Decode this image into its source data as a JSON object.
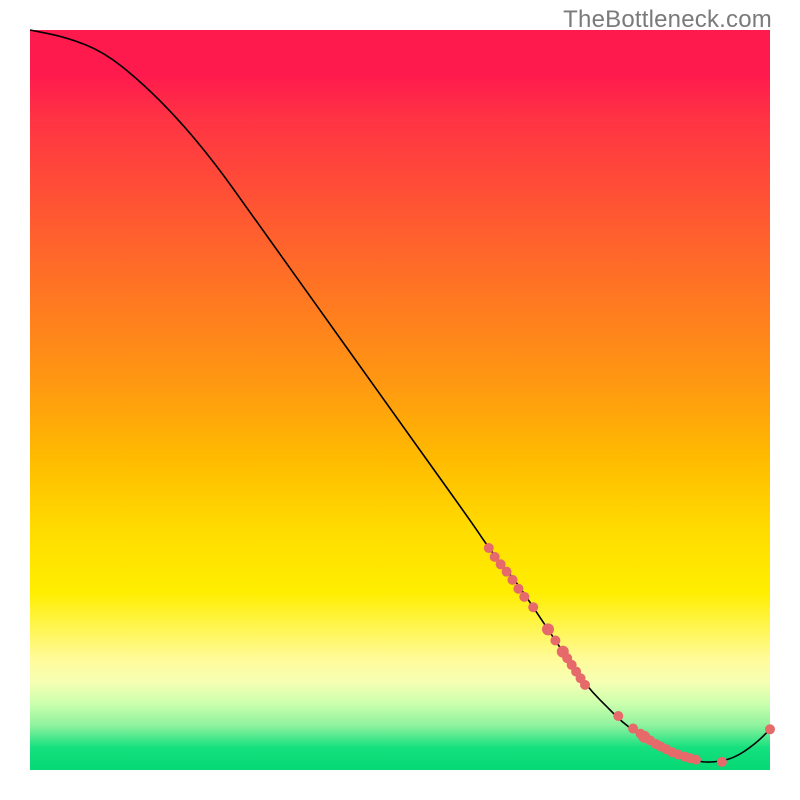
{
  "watermark": "TheBottleneck.com",
  "chart_data": {
    "type": "line",
    "title": "",
    "xlabel": "",
    "ylabel": "",
    "xlim": [
      0,
      100
    ],
    "ylim": [
      0,
      100
    ],
    "grid": false,
    "legend": false,
    "series": [
      {
        "name": "curve",
        "x": [
          0,
          5,
          10,
          15,
          20,
          25,
          30,
          35,
          40,
          45,
          50,
          55,
          60,
          62,
          64,
          66,
          68,
          70,
          72,
          74,
          76,
          78,
          80,
          82,
          84,
          86,
          88,
          90,
          92,
          95,
          98,
          100
        ],
        "y": [
          100,
          99,
          97,
          93,
          88,
          82,
          75,
          68,
          61,
          54,
          47,
          40,
          33,
          30,
          27.5,
          25,
          22,
          19,
          16,
          13,
          10.5,
          8.5,
          6.5,
          5,
          3.5,
          2.5,
          1.8,
          1.2,
          1,
          1.5,
          3.5,
          5.5
        ]
      }
    ],
    "markers": {
      "name": "highlight-points",
      "color": "#e66a6a",
      "points": [
        {
          "x": 62.0,
          "y": 30.0,
          "r": 5
        },
        {
          "x": 62.8,
          "y": 28.8,
          "r": 5
        },
        {
          "x": 63.6,
          "y": 27.8,
          "r": 5
        },
        {
          "x": 64.4,
          "y": 26.8,
          "r": 5
        },
        {
          "x": 65.2,
          "y": 25.7,
          "r": 5
        },
        {
          "x": 66.0,
          "y": 24.5,
          "r": 5
        },
        {
          "x": 66.8,
          "y": 23.4,
          "r": 5
        },
        {
          "x": 68.0,
          "y": 22.0,
          "r": 5
        },
        {
          "x": 70.0,
          "y": 19.0,
          "r": 6
        },
        {
          "x": 71.0,
          "y": 17.5,
          "r": 5
        },
        {
          "x": 72.0,
          "y": 16.0,
          "r": 6
        },
        {
          "x": 72.6,
          "y": 15.1,
          "r": 5
        },
        {
          "x": 73.2,
          "y": 14.2,
          "r": 5
        },
        {
          "x": 73.8,
          "y": 13.3,
          "r": 5
        },
        {
          "x": 74.4,
          "y": 12.4,
          "r": 5
        },
        {
          "x": 75.0,
          "y": 11.5,
          "r": 5
        },
        {
          "x": 79.5,
          "y": 7.3,
          "r": 5
        },
        {
          "x": 81.5,
          "y": 5.6,
          "r": 5
        },
        {
          "x": 82.5,
          "y": 4.9,
          "r": 5
        },
        {
          "x": 83.0,
          "y": 4.5,
          "r": 6
        },
        {
          "x": 83.8,
          "y": 4.0,
          "r": 5
        },
        {
          "x": 84.6,
          "y": 3.5,
          "r": 5
        },
        {
          "x": 85.2,
          "y": 3.2,
          "r": 5
        },
        {
          "x": 86.0,
          "y": 2.8,
          "r": 5
        },
        {
          "x": 86.8,
          "y": 2.4,
          "r": 5
        },
        {
          "x": 87.6,
          "y": 2.1,
          "r": 5
        },
        {
          "x": 88.5,
          "y": 1.8,
          "r": 5
        },
        {
          "x": 89.2,
          "y": 1.6,
          "r": 5
        },
        {
          "x": 90.0,
          "y": 1.4,
          "r": 5
        },
        {
          "x": 93.5,
          "y": 1.1,
          "r": 5
        },
        {
          "x": 100.0,
          "y": 5.5,
          "r": 5
        }
      ]
    }
  }
}
